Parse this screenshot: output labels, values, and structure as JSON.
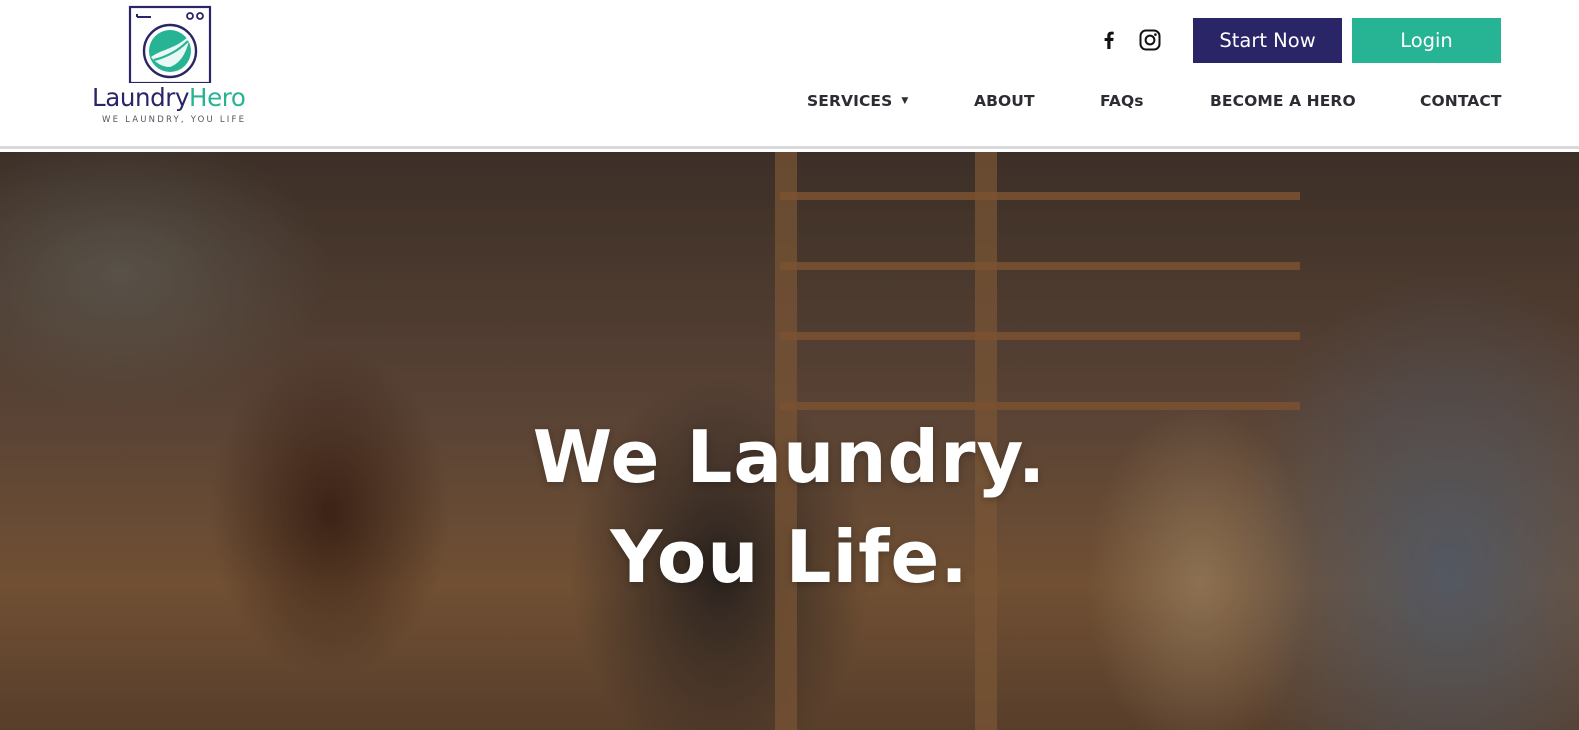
{
  "brand": {
    "name_part1": "Laundry",
    "name_part2": "Hero",
    "tagline": "WE LAUNDRY, YOU LIFE",
    "colors": {
      "primary": "#2a2566",
      "accent": "#27b495",
      "nav_text": "#2c2c33"
    }
  },
  "header": {
    "social": [
      {
        "icon": "facebook-icon"
      },
      {
        "icon": "instagram-icon"
      }
    ],
    "buttons": {
      "start_now": "Start Now",
      "login": "Login"
    },
    "nav": {
      "services": "SERVICES",
      "about": "ABOUT",
      "faqs": "FAQs",
      "become_a_hero": "BECOME A HERO",
      "contact": "CONTACT"
    }
  },
  "hero": {
    "line1": "We Laundry.",
    "line2": "You Life."
  }
}
